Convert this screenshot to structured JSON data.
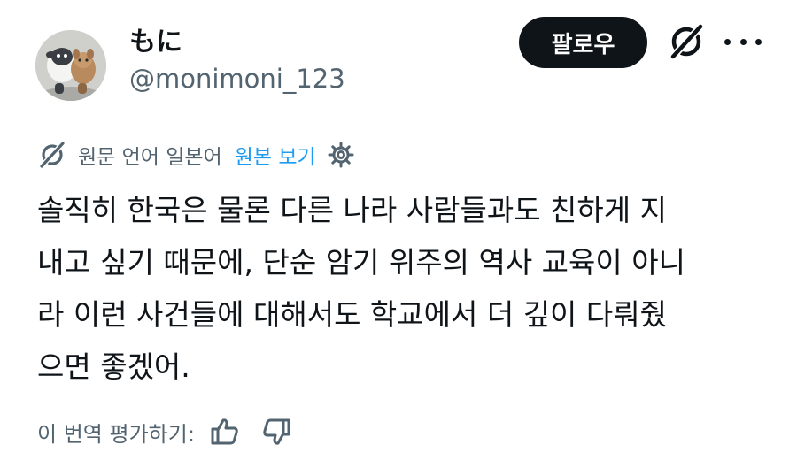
{
  "profile": {
    "display_name": "もに",
    "handle": "@monimoni_123",
    "avatar_icon": "plush-toy-avatar"
  },
  "header": {
    "follow_label": "팔로우",
    "grok_icon": "grok-icon",
    "more_icon": "more-icon"
  },
  "translation": {
    "icon": "grok-icon",
    "info_text": "원문 언어 일본어",
    "show_original_label": "원본 보기",
    "settings_icon": "gear-icon"
  },
  "post": {
    "lines": [
      "솔직히 한국은 물론 다른 나라 사람들과도 친하게 지",
      "내고 싶기 때문에, 단순 암기 위주의 역사 교육이 아니",
      "라 이런 사건들에 대해서도 학교에서 더 깊이 다뤄줬",
      "으면 좋겠어."
    ]
  },
  "rating": {
    "label": "이 번역 평가하기:",
    "thumbs_up_icon": "thumbs-up-icon",
    "thumbs_down_icon": "thumbs-down-icon"
  },
  "colors": {
    "text": "#0f1419",
    "secondary": "#536471",
    "link": "#1d9bf0",
    "button_bg": "#0f1419"
  }
}
